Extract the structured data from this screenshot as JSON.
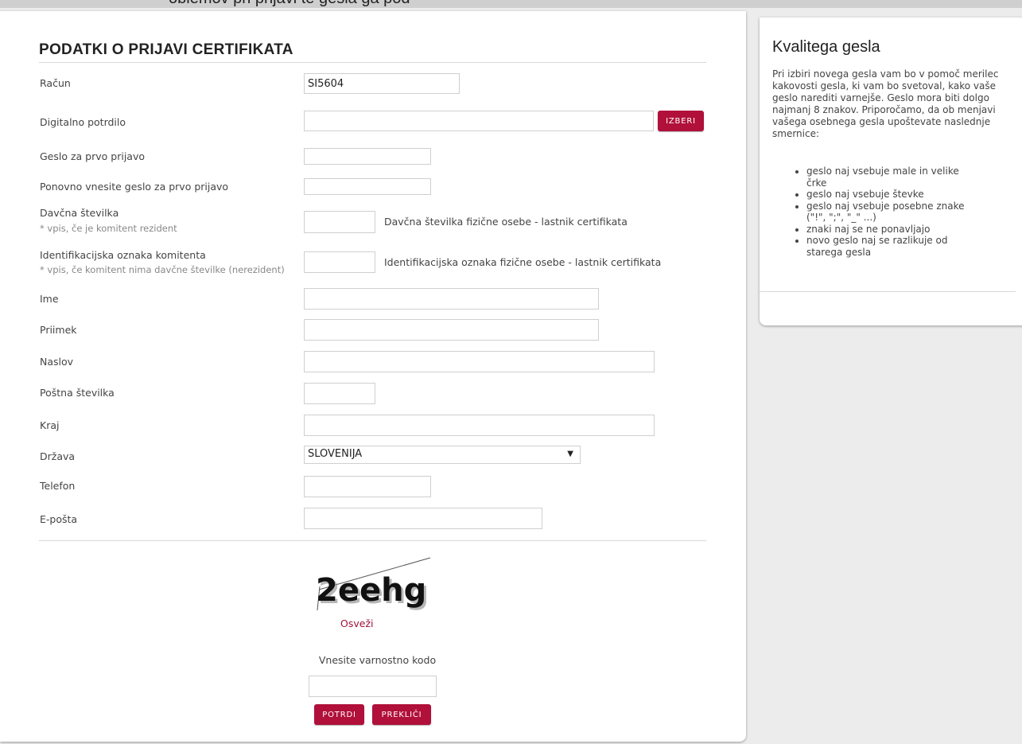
{
  "top_strip": "oblemov pri prijavi te gesla ga pod",
  "form": {
    "title": "PODATKI O PRIJAVI CERTIFIKATA",
    "fields": {
      "racun": {
        "label": "Račun",
        "value": "SI5604"
      },
      "digitalno": {
        "label": "Digitalno potrdilo",
        "value": "",
        "button": "IZBERI"
      },
      "geslo": {
        "label": "Geslo za prvo prijavo",
        "value": ""
      },
      "geslo2": {
        "label": "Ponovno vnesite geslo za prvo prijavo",
        "value": ""
      },
      "davcna": {
        "label": "Davčna številka",
        "sublabel": "* vpis, če je komitent rezident",
        "value": "",
        "hint": "Davčna številka fizične osebe - lastnik certifikata"
      },
      "identifikacijska": {
        "label": "Identifikacijska oznaka komitenta",
        "sublabel": "* vpis, če komitent nima davčne številke (nerezident)",
        "value": "",
        "hint": "Identifikacijska oznaka fizične osebe - lastnik certifikata"
      },
      "ime": {
        "label": "Ime",
        "value": ""
      },
      "priimek": {
        "label": "Priimek",
        "value": ""
      },
      "naslov": {
        "label": "Naslov",
        "value": ""
      },
      "postna": {
        "label": "Poštna številka",
        "value": ""
      },
      "kraj": {
        "label": "Kraj",
        "value": ""
      },
      "drzava": {
        "label": "Država",
        "value": "SLOVENIJA"
      },
      "telefon": {
        "label": "Telefon",
        "value": ""
      },
      "eposta": {
        "label": "E-pošta",
        "value": ""
      }
    },
    "captcha": {
      "code": "2eehg",
      "refresh": "Osveži",
      "prompt": "Vnesite varnostno kodo",
      "value": ""
    },
    "buttons": {
      "confirm": "POTRDI",
      "cancel": "PREKLIČI"
    }
  },
  "sidebar": {
    "title": "Kvalitega gesla",
    "text": "Pri izbiri novega gesla vam bo v pomoč merilec kakovosti gesla, ki vam bo svetoval, kako vaše geslo narediti varnejše. Geslo mora biti dolgo najmanj 8 znakov. Priporočamo, da ob menjavi vašega osebnega gesla upoštevate naslednje smernice:",
    "tips": [
      "geslo naj vsebuje male in velike črke",
      "geslo naj vsebuje števke",
      "geslo naj vsebuje posebne znake (\"!\", \";\", \"_\" ...)",
      "znaki naj se ne ponavljajo",
      "novo geslo naj se razlikuje od starega gesla"
    ]
  },
  "colors": {
    "accent": "#b0103a",
    "link": "#a0113a",
    "background": "#ececec"
  }
}
